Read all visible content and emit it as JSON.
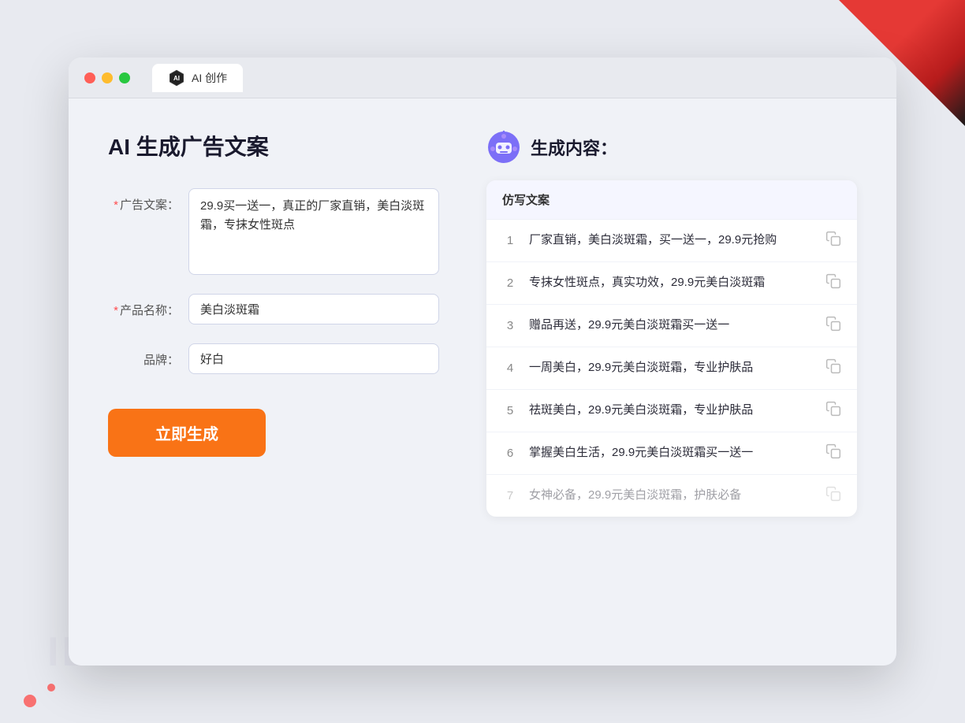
{
  "window": {
    "tab_label": "AI 创作"
  },
  "left_panel": {
    "page_title": "AI 生成广告文案",
    "form": {
      "ad_copy_label": "广告文案：",
      "ad_copy_required": "*",
      "ad_copy_value": "29.9买一送一，真正的厂家直销，美白淡斑霜，专抹女性斑点",
      "product_name_label": "产品名称：",
      "product_name_required": "*",
      "product_name_value": "美白淡斑霜",
      "brand_label": "品牌：",
      "brand_value": "好白",
      "generate_button": "立即生成"
    }
  },
  "right_panel": {
    "title": "生成内容：",
    "table_header": "仿写文案",
    "results": [
      {
        "num": "1",
        "text": "厂家直销，美白淡斑霜，买一送一，29.9元抢购",
        "dimmed": false
      },
      {
        "num": "2",
        "text": "专抹女性斑点，真实功效，29.9元美白淡斑霜",
        "dimmed": false
      },
      {
        "num": "3",
        "text": "赠品再送，29.9元美白淡斑霜买一送一",
        "dimmed": false
      },
      {
        "num": "4",
        "text": "一周美白，29.9元美白淡斑霜，专业护肤品",
        "dimmed": false
      },
      {
        "num": "5",
        "text": "祛斑美白，29.9元美白淡斑霜，专业护肤品",
        "dimmed": false
      },
      {
        "num": "6",
        "text": "掌握美白生活，29.9元美白淡斑霜买一送一",
        "dimmed": false
      },
      {
        "num": "7",
        "text": "女神必备，29.9元美白淡斑霜，护肤必备",
        "dimmed": true
      }
    ]
  },
  "watermark": {
    "text": "IBM EF"
  },
  "colors": {
    "orange": "#f97316",
    "accent": "#6366f1",
    "bg": "#f0f2f7"
  }
}
